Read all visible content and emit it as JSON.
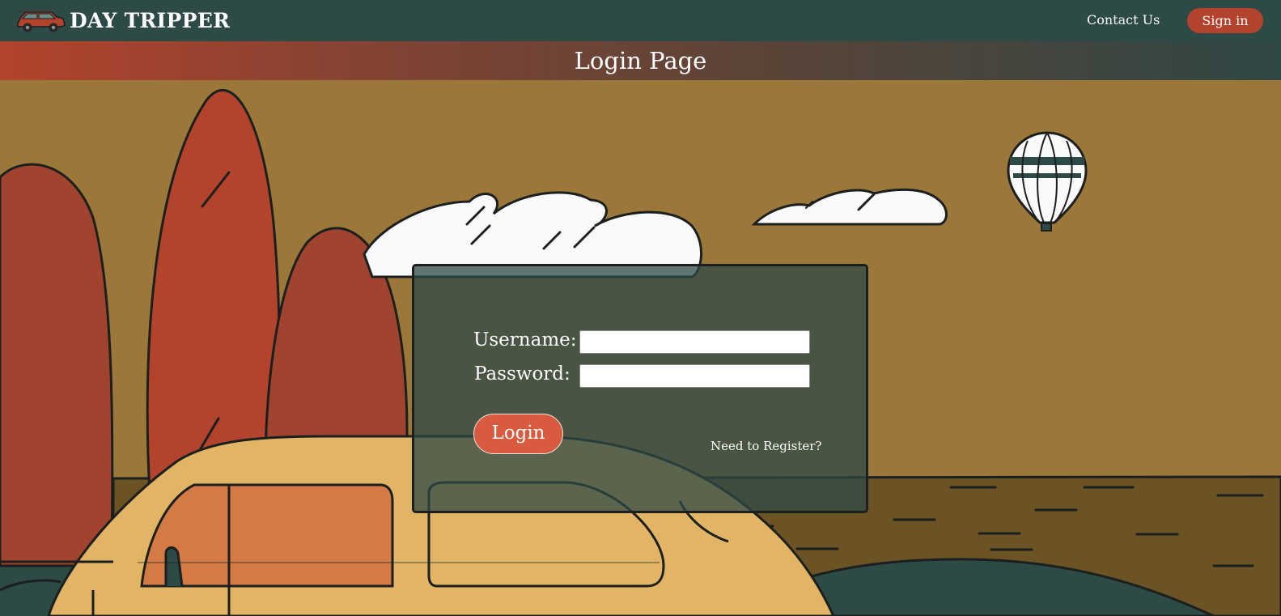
{
  "navbar": {
    "brand_title": "DAY TRIPPER",
    "logo_icon": "station-wagon-car-icon",
    "contact_label": "Contact Us",
    "signin_label": "Sign in"
  },
  "banner": {
    "title": "Login Page"
  },
  "login_form": {
    "username_label": "Username:",
    "username_value": "",
    "password_label": "Password:",
    "password_value": "",
    "login_button_label": "Login",
    "register_link_label": "Need to Register?"
  },
  "colors": {
    "navbar": "#2e4a46",
    "accent": "#b3432d",
    "login_button": "#d95b3f",
    "sky": "#9b7839"
  }
}
